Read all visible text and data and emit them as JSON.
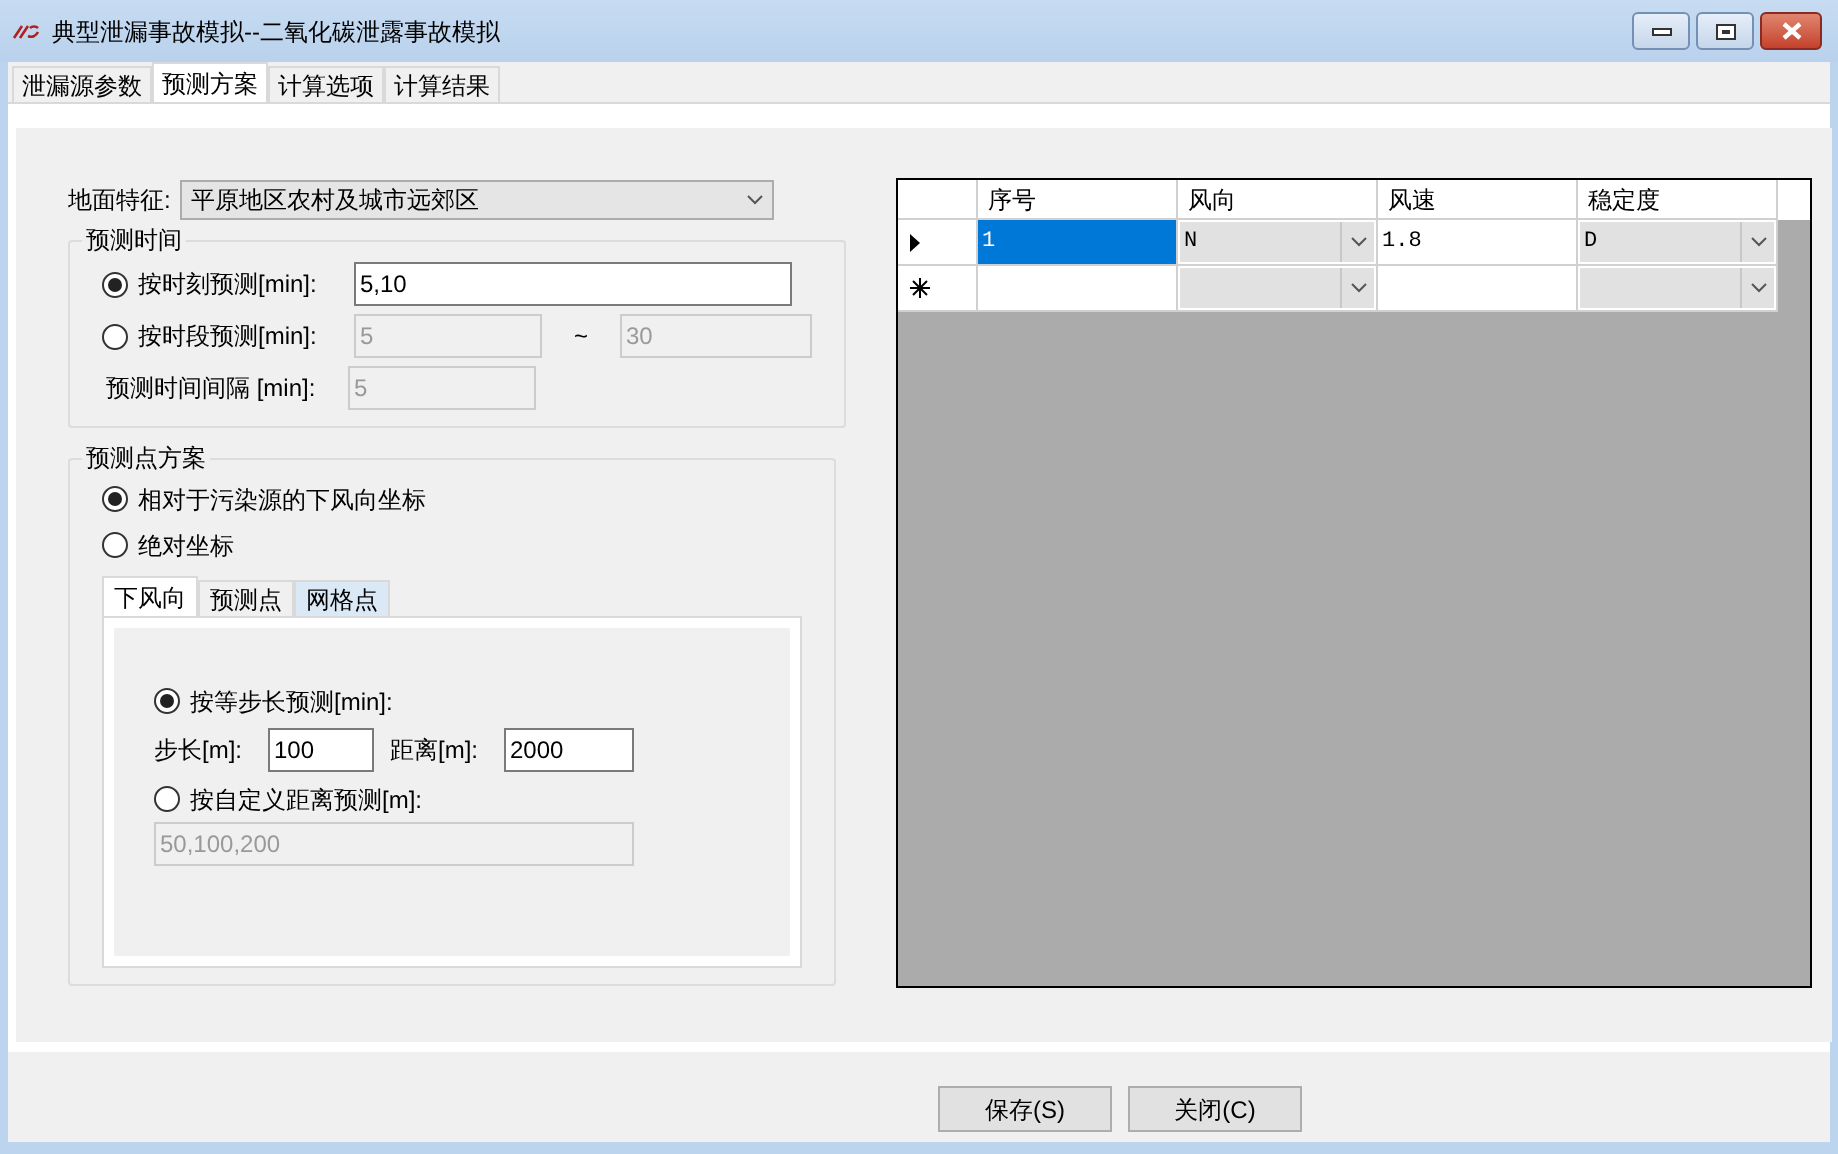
{
  "window": {
    "title": "典型泄漏事故模拟--二氧化碳泄露事故模拟"
  },
  "tabs": [
    {
      "label": "泄漏源参数",
      "selected": false
    },
    {
      "label": "预测方案",
      "selected": true
    },
    {
      "label": "计算选项",
      "selected": false
    },
    {
      "label": "计算结果",
      "selected": false
    }
  ],
  "terrain": {
    "label": "地面特征:",
    "value": "平原地区农村及城市远郊区"
  },
  "time_group": {
    "title": "预测时间",
    "options": [
      {
        "label": "按时刻预测[min]:",
        "selected": true,
        "value": "5,10"
      },
      {
        "label": "按时段预测[min]:",
        "selected": false,
        "from": "5",
        "separator": "~",
        "to": "30"
      }
    ],
    "interval": {
      "label": "预测时间间隔 [min]:",
      "value": "5"
    }
  },
  "point_group": {
    "title": "预测点方案",
    "options": [
      {
        "label": "相对于污染源的下风向坐标",
        "selected": true
      },
      {
        "label": "绝对坐标",
        "selected": false
      }
    ],
    "subtabs": [
      {
        "label": "下风向",
        "selected": true
      },
      {
        "label": "预测点",
        "selected": false
      },
      {
        "label": "网格点",
        "selected": false
      }
    ],
    "step_option": {
      "label": "按等步长预测[min]:",
      "selected": true
    },
    "step": {
      "label": "步长[m]:",
      "value": "100"
    },
    "distance": {
      "label": "距离[m]:",
      "value": "2000"
    },
    "custom_option": {
      "label": "按自定义距离预测[m]:",
      "selected": false,
      "value": "50,100,200"
    }
  },
  "grid": {
    "columns": [
      "序号",
      "风向",
      "风速",
      "稳定度"
    ],
    "rows": [
      {
        "kind": "current",
        "selected": true,
        "cells": [
          "1",
          "N",
          "1.8",
          "D"
        ]
      },
      {
        "kind": "new",
        "selected": false,
        "cells": [
          "",
          "",
          "",
          ""
        ]
      }
    ]
  },
  "buttons": [
    "保存(S)",
    "关闭(C)"
  ]
}
